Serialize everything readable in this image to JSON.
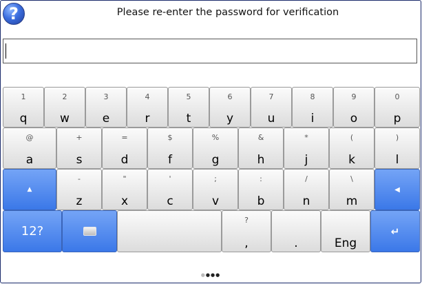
{
  "dialog": {
    "title": "Please re-enter the password for verification",
    "help_icon_glyph": "?",
    "password_value": ""
  },
  "keyboard": {
    "row1": [
      {
        "sub": "1",
        "main": "q"
      },
      {
        "sub": "2",
        "main": "w"
      },
      {
        "sub": "3",
        "main": "e"
      },
      {
        "sub": "4",
        "main": "r"
      },
      {
        "sub": "5",
        "main": "t"
      },
      {
        "sub": "6",
        "main": "y"
      },
      {
        "sub": "7",
        "main": "u"
      },
      {
        "sub": "8",
        "main": "i"
      },
      {
        "sub": "9",
        "main": "o"
      },
      {
        "sub": "0",
        "main": "p"
      }
    ],
    "row2": [
      {
        "sub": "@",
        "main": "a"
      },
      {
        "sub": "+",
        "main": "s"
      },
      {
        "sub": "=",
        "main": "d"
      },
      {
        "sub": "$",
        "main": "f"
      },
      {
        "sub": "%",
        "main": "g"
      },
      {
        "sub": "&",
        "main": "h"
      },
      {
        "sub": "*",
        "main": "j"
      },
      {
        "sub": "(",
        "main": "k"
      },
      {
        "sub": ")",
        "main": "l"
      }
    ],
    "row3": [
      {
        "sub": "-",
        "main": "z"
      },
      {
        "sub": "\"",
        "main": "x"
      },
      {
        "sub": "'",
        "main": "c"
      },
      {
        "sub": ";",
        "main": "v"
      },
      {
        "sub": ":",
        "main": "b"
      },
      {
        "sub": "/",
        "main": "n"
      },
      {
        "sub": "\\",
        "main": "m"
      }
    ],
    "shift_icon": "arrow-up-icon",
    "backspace_icon": "arrow-left-icon",
    "numbers_label": "12?",
    "keyboard_icon": "keyboard-icon",
    "space_label": "",
    "comma_sub": "?",
    "comma_main": ",",
    "period_main": ".",
    "language_label": "Eng",
    "enter_icon": "enter-icon",
    "accent_color": "#3b78e8"
  },
  "pager": {
    "pages": 4,
    "current": 1
  }
}
